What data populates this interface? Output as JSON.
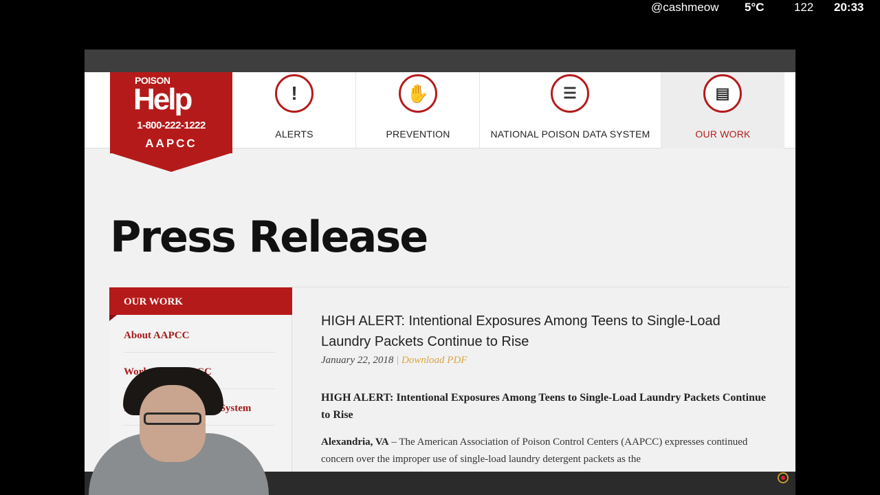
{
  "stream": {
    "username": "@cashmeow",
    "temperature": "5°C",
    "count": "122",
    "time": "20:33"
  },
  "logo": {
    "poison": "POISON",
    "help": "Help",
    "phone": "1-800-222-1222",
    "org": "AAPCC"
  },
  "nav": {
    "items": [
      {
        "label": "ALERTS",
        "icon": "exclamation-icon"
      },
      {
        "label": "PREVENTION",
        "icon": "hand-icon"
      },
      {
        "label": "NATIONAL POISON DATA SYSTEM",
        "icon": "data-stack-icon"
      },
      {
        "label": "OUR WORK",
        "icon": "document-icon"
      }
    ],
    "active": "OUR WORK"
  },
  "page": {
    "title": "Press Release"
  },
  "sidebar": {
    "heading": "OUR WORK",
    "items": [
      {
        "label": "About AAPCC"
      },
      {
        "label": "Work With AAPCC"
      },
      {
        "label": "National Poison Data System"
      }
    ]
  },
  "article": {
    "headline": "HIGH ALERT: Intentional Exposures Among Teens to Single-Load Laundry Packets Continue to Rise",
    "date": "January 22, 2018",
    "separator": "|",
    "download_label": "Download PDF",
    "subheadline": "HIGH ALERT: Intentional Exposures Among Teens to Single-Load Laundry Packets Continue to Rise",
    "dateline": "Alexandria, VA",
    "body": " – The American Association of Poison Control Centers (AAPCC) expresses continued concern over the improper use of single-load laundry detergent packets as the"
  },
  "colors": {
    "brand_red": "#b51a1a",
    "link_gold": "#d9a441",
    "background": "#f1f1f1"
  }
}
